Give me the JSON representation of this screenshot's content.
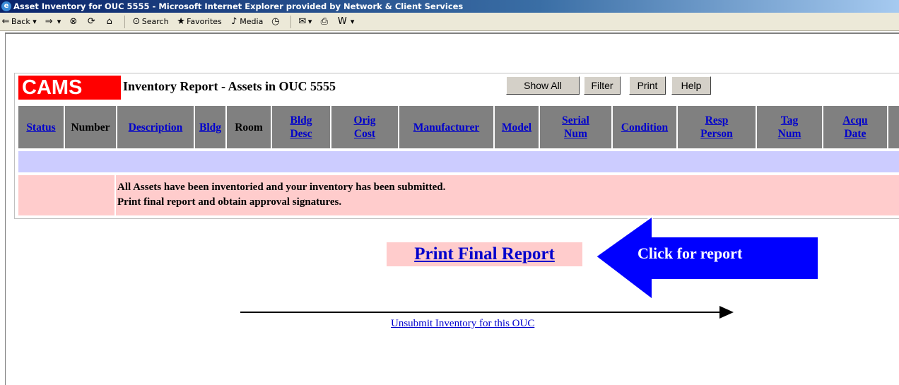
{
  "window": {
    "title": "Asset Inventory for OUC 5555 - Microsoft Internet Explorer provided by Network & Client Services"
  },
  "toolbar": {
    "back": "Back",
    "search": "Search",
    "favorites": "Favorites",
    "media": "Media"
  },
  "report": {
    "logo": "CAMS",
    "title": "Inventory Report - Assets in OUC 5555",
    "buttons": {
      "show_all": "Show All",
      "filter": "Filter",
      "print": "Print",
      "help": "Help"
    },
    "columns": {
      "status": "Status",
      "number": "Number",
      "description": "Description",
      "bldg": "Bldg",
      "room": "Room",
      "bldg_desc_1": "Bldg",
      "bldg_desc_2": "Desc",
      "orig_cost_1": "Orig",
      "orig_cost_2": "Cost",
      "manufacturer": "Manufacturer",
      "model": "Model",
      "serial_num_1": "Serial",
      "serial_num_2": "Num",
      "condition": "Condition",
      "resp_person_1": "Resp",
      "resp_person_2": "Person",
      "tag_num_1": "Tag",
      "tag_num_2": "Num",
      "acqu_date_1": "Acqu",
      "acqu_date_2": "Date"
    },
    "message_line1": "All Assets have been inventoried and your inventory has been submitted.",
    "message_line2": "Print final report and obtain approval signatures."
  },
  "actions": {
    "print_final_report": "Print Final Report",
    "callout": "Click for report",
    "unsubmit": "Unsubmit Inventory for this OUC"
  },
  "colors": {
    "logo_bg": "#ff0000",
    "header_bg": "#808080",
    "blue_row": "#ccccff",
    "pink_row": "#ffcccc",
    "callout": "#0000ff"
  }
}
